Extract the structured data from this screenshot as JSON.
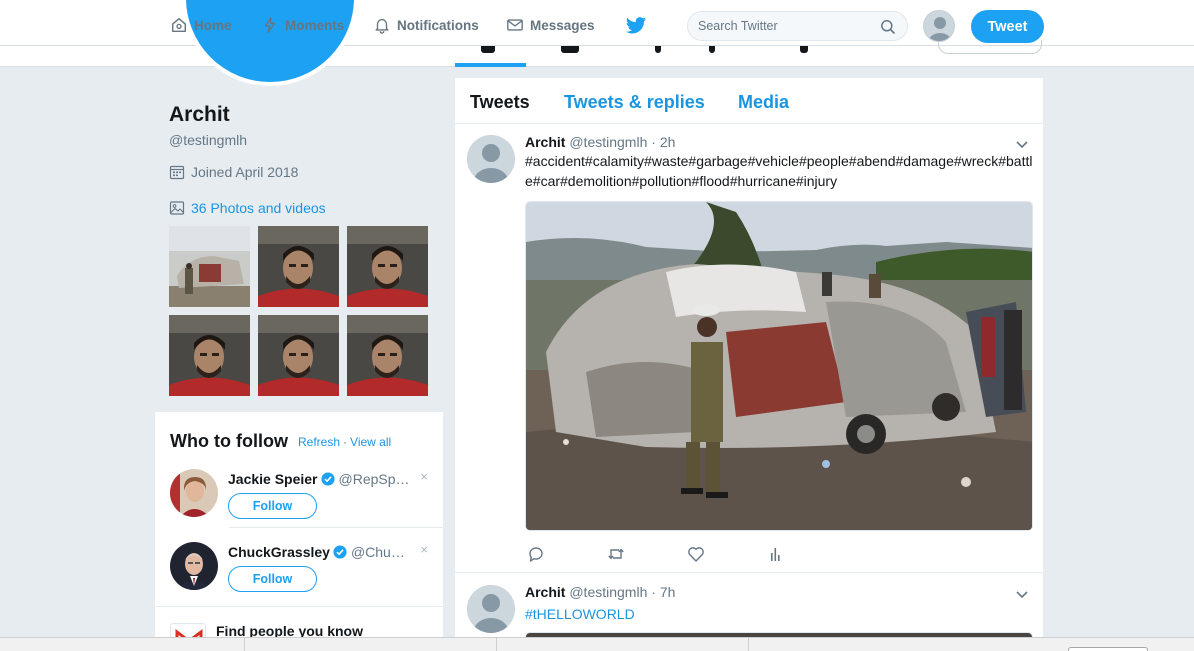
{
  "nav": {
    "home": "Home",
    "moments": "Moments",
    "notifications": "Notifications",
    "messages": "Messages",
    "search_placeholder": "Search Twitter",
    "tweet_button": "Tweet"
  },
  "profile": {
    "name": "Archit",
    "handle": "@testingmlh",
    "joined": "Joined April 2018",
    "photos_link": "36 Photos and videos"
  },
  "who_to_follow": {
    "title": "Who to follow",
    "refresh": "Refresh",
    "separator": "·",
    "view_all": "View all",
    "suggestions": [
      {
        "name": "Jackie Speier",
        "handle": "@RepSp…",
        "follow": "Follow",
        "dismiss": "×"
      },
      {
        "name": "ChuckGrassley",
        "handle": "@Chu…",
        "follow": "Follow",
        "dismiss": "×"
      }
    ],
    "find_people": "Find people you know"
  },
  "timeline": {
    "tabs": [
      "Tweets",
      "Tweets & replies",
      "Media"
    ],
    "tweets": [
      {
        "name": "Archit",
        "handle": "@testingmlh",
        "time": "· 2h",
        "text": "#accident#calamity#waste#garbage#vehicle#people#abend#damage#wreck#battle#car#demolition#pollution#flood#hurricane#injury"
      },
      {
        "name": "Archit",
        "handle": "@testingmlh",
        "time": "· 7h",
        "text": "#tHELLOWORLD"
      }
    ]
  },
  "colors": {
    "accent": "#1da1f2",
    "link": "#1b95e0",
    "muted": "#657786",
    "background": "#e6ecf0"
  }
}
